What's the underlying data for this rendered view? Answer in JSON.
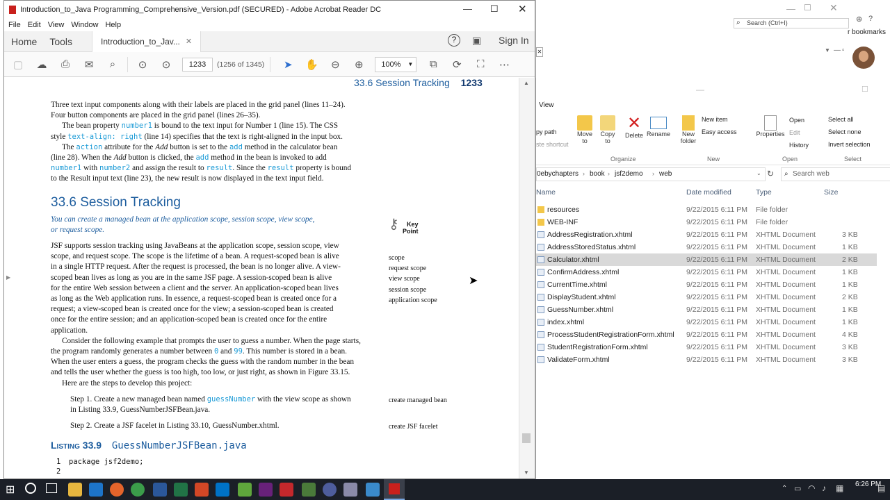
{
  "acrobat": {
    "title": "Introduction_to_Java Programming_Comprehensive_Version.pdf (SECURED) - Adobe Acrobat Reader DC",
    "menu": [
      "File",
      "Edit",
      "View",
      "Window",
      "Help"
    ],
    "tabs": {
      "home": "Home",
      "tools": "Tools",
      "doc": "Introduction_to_Jav..."
    },
    "sign_in": "Sign In",
    "page_input": "1233",
    "page_count": "(1256 of 1345)",
    "zoom": "100%"
  },
  "pdf": {
    "running_head": "33.6  Session Tracking",
    "page_num": "1233",
    "p1": [
      "Three text input components along with their labels are placed in the grid panel (lines 11–24).",
      "Four button components are placed in the grid panel (lines 26–35)."
    ],
    "p2a": "The bean property ",
    "p2_code1": "number1",
    "p2b": " is bound to the text input for Number 1 (line 15). The CSS",
    "p2c": "style ",
    "p2_code2": "text-align: right",
    "p2d": " (line 14) specifies that the text is right-aligned in the input box.",
    "p3a": "The ",
    "p3_code1": "action",
    "p3b": " attribute for the ",
    "p3_it1": "Add",
    "p3c": " button is set to the ",
    "p3_code2": "add",
    "p3d": " method in the calculator bean",
    "p3e": "(line 28). When the ",
    "p3_it2": "Add",
    "p3f": " button is clicked, the ",
    "p3_code3": "add",
    "p3g": " method in the bean is invoked to add",
    "p3_code4": "number1",
    "p3h": " with ",
    "p3_code5": "number2",
    "p3i": " and assign the result to ",
    "p3_code6": "result",
    "p3j": ". Since the ",
    "p3_code7": "result",
    "p3k": " property is bound",
    "p3l": "to the Result input text (line 23), the new result is now displayed in the text input field.",
    "section": "33.6  Session Tracking",
    "keypoint": "You can create a managed bean at the application scope, session scope, view scope,",
    "keypoint2": "or request scope.",
    "key_label1": "Key",
    "key_label2": "Point",
    "body_lines": [
      "JSF supports session tracking using JavaBeans at the application scope, session scope, view",
      "scope, and request scope. The scope is the lifetime of a bean. A request-scoped bean is alive",
      "in a single HTTP request. After the request is processed, the bean is no longer alive. A view-",
      "scoped bean lives as long as you are in the same JSF page. A session-scoped bean is alive",
      "for the entire Web session between a client and the server. An application-scoped bean lives",
      "as long as the Web application runs. In essence, a request-scoped bean is created once for a",
      "request; a view-scoped bean is created once for the view; a session-scoped bean is created",
      "once for the entire session; and an application-scoped bean is created once for the entire",
      "application."
    ],
    "margin_notes": [
      "scope",
      "request scope",
      "view scope",
      "session scope",
      "application scope"
    ],
    "consider_a": "Consider the following example that prompts the user to guess a number. When the page starts,",
    "consider_b1": "the program randomly generates a number between ",
    "consider_code1": "0",
    "consider_b2": " and ",
    "consider_code2": "99",
    "consider_b3": ". This number is stored in a bean.",
    "consider_c": "When the user enters a guess, the program checks the guess with the random number in the bean",
    "consider_d": "and tells the user whether the guess is too high, too low, or just right, as shown in Figure 33.15.",
    "steps_intro": "Here are the steps to develop this project:",
    "step1a": "Step 1. Create a new managed bean named ",
    "step1_code": "guessNumber",
    "step1b": " with the view scope as shown",
    "step1c": "in Listing 33.9, GuessNumberJSFBean.java.",
    "step1_note": "create managed bean",
    "step2": "Step 2. Create a JSF facelet in Listing 33.10, GuessNumber.xhtml.",
    "step2_note": "create JSF facelet",
    "listing_label": "Listing 33.9",
    "listing_file": "GuessNumberJSFBean.java",
    "code_lines": [
      {
        "n": "1",
        "t": "package jsf2demo;"
      },
      {
        "n": "2",
        "t": ""
      }
    ]
  },
  "bgwin": {
    "search_placeholder": "Search (Ctrl+I)",
    "bookmarks": "r bookmarks"
  },
  "explorer": {
    "tab": "View",
    "ribbon": {
      "copy_path": "py path",
      "paste_shortcut": "ste shortcut",
      "move_to": "Move to",
      "copy_to": "Copy to",
      "delete": "Delete",
      "rename": "Rename",
      "new_folder": "New folder",
      "new_item": "New item",
      "easy_access": "Easy access",
      "properties": "Properties",
      "open": "Open",
      "edit": "Edit",
      "history": "History",
      "select_all": "Select all",
      "select_none": "Select none",
      "invert_selection": "Invert selection",
      "group_organize": "Organize",
      "group_new": "New",
      "group_open": "Open",
      "group_select": "Select"
    },
    "breadcrumb": [
      "0ebychapters",
      "book",
      "jsf2demo",
      "web"
    ],
    "search_placeholder": "Search web",
    "columns": [
      "Name",
      "Date modified",
      "Type",
      "Size"
    ],
    "files": [
      {
        "name": "resources",
        "date": "9/22/2015 6:11 PM",
        "type": "File folder",
        "size": "",
        "folder": true
      },
      {
        "name": "WEB-INF",
        "date": "9/22/2015 6:11 PM",
        "type": "File folder",
        "size": "",
        "folder": true
      },
      {
        "name": "AddressRegistration.xhtml",
        "date": "9/22/2015 6:11 PM",
        "type": "XHTML Document",
        "size": "3 KB"
      },
      {
        "name": "AddressStoredStatus.xhtml",
        "date": "9/22/2015 6:11 PM",
        "type": "XHTML Document",
        "size": "1 KB"
      },
      {
        "name": "Calculator.xhtml",
        "date": "9/22/2015 6:11 PM",
        "type": "XHTML Document",
        "size": "2 KB",
        "selected": true
      },
      {
        "name": "ConfirmAddress.xhtml",
        "date": "9/22/2015 6:11 PM",
        "type": "XHTML Document",
        "size": "1 KB"
      },
      {
        "name": "CurrentTime.xhtml",
        "date": "9/22/2015 6:11 PM",
        "type": "XHTML Document",
        "size": "1 KB"
      },
      {
        "name": "DisplayStudent.xhtml",
        "date": "9/22/2015 6:11 PM",
        "type": "XHTML Document",
        "size": "2 KB"
      },
      {
        "name": "GuessNumber.xhtml",
        "date": "9/22/2015 6:11 PM",
        "type": "XHTML Document",
        "size": "1 KB"
      },
      {
        "name": "index.xhtml",
        "date": "9/22/2015 6:11 PM",
        "type": "XHTML Document",
        "size": "1 KB"
      },
      {
        "name": "ProcessStudentRegistrationForm.xhtml",
        "date": "9/22/2015 6:11 PM",
        "type": "XHTML Document",
        "size": "4 KB"
      },
      {
        "name": "StudentRegistrationForm.xhtml",
        "date": "9/22/2015 6:11 PM",
        "type": "XHTML Document",
        "size": "3 KB"
      },
      {
        "name": "ValidateForm.xhtml",
        "date": "9/22/2015 6:11 PM",
        "type": "XHTML Document",
        "size": "3 KB"
      }
    ]
  },
  "taskbar": {
    "time": "6:26 PM",
    "date": ""
  },
  "colors": {
    "code": "#1a9ad6",
    "heading": "#1d5d9e",
    "acrobat_red": "#c8201c",
    "selected_row": "#d9d9d9"
  }
}
